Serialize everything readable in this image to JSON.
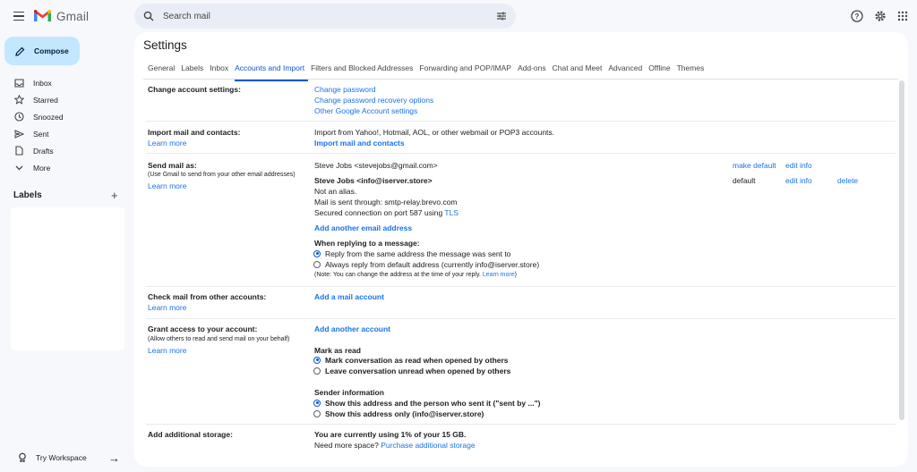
{
  "app": {
    "name": "Gmail"
  },
  "search": {
    "placeholder": "Search mail"
  },
  "sidebar": {
    "compose": "Compose",
    "items": [
      {
        "label": "Inbox",
        "icon": "inbox-icon"
      },
      {
        "label": "Starred",
        "icon": "star-icon"
      },
      {
        "label": "Snoozed",
        "icon": "clock-icon"
      },
      {
        "label": "Sent",
        "icon": "send-icon"
      },
      {
        "label": "Drafts",
        "icon": "draft-icon"
      },
      {
        "label": "More",
        "icon": "chevron-down-icon"
      }
    ],
    "labels_heading": "Labels",
    "try_workspace": "Try Workspace"
  },
  "settings": {
    "title": "Settings",
    "tabs": [
      "General",
      "Labels",
      "Inbox",
      "Accounts and Import",
      "Filters and Blocked Addresses",
      "Forwarding and POP/IMAP",
      "Add-ons",
      "Chat and Meet",
      "Advanced",
      "Offline",
      "Themes"
    ],
    "active_tab": "Accounts and Import",
    "change_account": {
      "label": "Change account settings:",
      "links": [
        "Change password",
        "Change password recovery options",
        "Other Google Account settings"
      ]
    },
    "import": {
      "label": "Import mail and contacts:",
      "learn_more": "Learn more",
      "description": "Import from Yahoo!, Hotmail, AOL, or other webmail or POP3 accounts.",
      "action": "Import mail and contacts"
    },
    "send_as": {
      "label": "Send mail as:",
      "sub": "(Use Gmail to send from your other email addresses)",
      "learn_more": "Learn more",
      "account1": "Steve Jobs <stevejobs@gmail.com>",
      "account1_make_default": "make default",
      "account1_edit": "edit info",
      "account2": "Steve Jobs <info@iserver.store>",
      "account2_default": "default",
      "account2_edit": "edit info",
      "account2_delete": "delete",
      "not_alias": "Not an alias.",
      "sent_through": "Mail is sent through: smtp-relay.brevo.com",
      "secured": "Secured connection on port 587 using ",
      "tls": "TLS",
      "add_another": "Add another email address",
      "reply_heading": "When replying to a message:",
      "reply_opt1": "Reply from the same address the message was sent to",
      "reply_opt2": "Always reply from default address (currently info@iserver.store)",
      "note": "(Note: You can change the address at the time of your reply. ",
      "note_link": "Learn more",
      "note_end": ")"
    },
    "check_mail": {
      "label": "Check mail from other accounts:",
      "learn_more": "Learn more",
      "action": "Add a mail account"
    },
    "grant": {
      "label": "Grant access to your account:",
      "sub": "(Allow others to read and send mail on your behalf)",
      "learn_more": "Learn more",
      "action": "Add another account",
      "mark_heading": "Mark as read",
      "mark_opt1": "Mark conversation as read when opened by others",
      "mark_opt2": "Leave conversation unread when opened by others",
      "sender_heading": "Sender information",
      "sender_opt1": "Show this address and the person who sent it (\"sent by ...\")",
      "sender_opt2": "Show this address only (info@iserver.store)"
    },
    "storage": {
      "label": "Add additional storage:",
      "usage": "You are currently using 1% of your 15 GB.",
      "need_more": "Need more space? ",
      "purchase": "Purchase additional storage"
    }
  }
}
